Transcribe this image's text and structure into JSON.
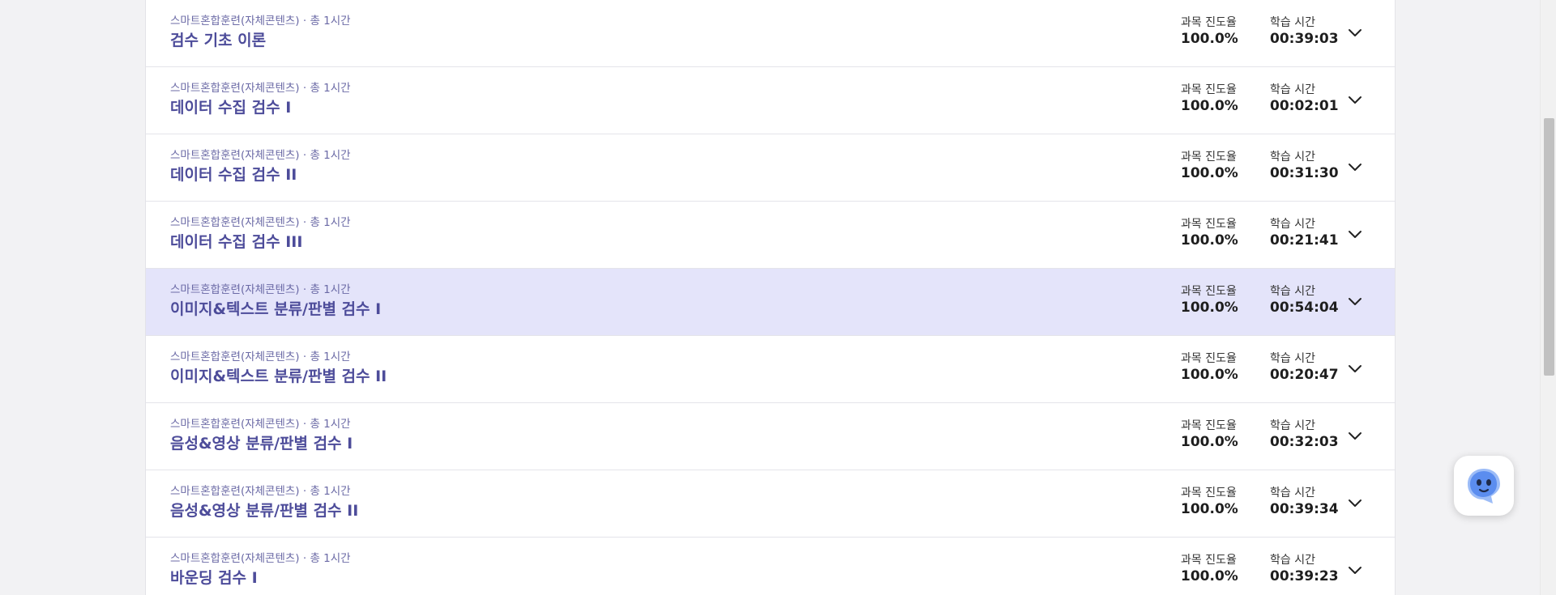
{
  "labels": {
    "progress": "과목 진도율",
    "time": "학습 시간"
  },
  "colors": {
    "title": "#4d4c9a",
    "meta": "#6b6aa6",
    "highlight_row": "#e4e4fa",
    "chatbot_accent": "#5b8def"
  },
  "icons": {
    "expand": "chevron-down-icon",
    "chatbot": "chatbot-icon"
  },
  "courses": [
    {
      "meta": "스마트혼합훈련(자체콘텐츠) · 총 1시간",
      "title": "검수 기초 이론",
      "progress": "100.0%",
      "time": "00:39:03",
      "highlighted": false
    },
    {
      "meta": "스마트혼합훈련(자체콘텐츠) · 총 1시간",
      "title": "데이터 수집 검수 I",
      "progress": "100.0%",
      "time": "00:02:01",
      "highlighted": false
    },
    {
      "meta": "스마트혼합훈련(자체콘텐츠) · 총 1시간",
      "title": "데이터 수집 검수 II",
      "progress": "100.0%",
      "time": "00:31:30",
      "highlighted": false
    },
    {
      "meta": "스마트혼합훈련(자체콘텐츠) · 총 1시간",
      "title": "데이터 수집 검수 III",
      "progress": "100.0%",
      "time": "00:21:41",
      "highlighted": false
    },
    {
      "meta": "스마트혼합훈련(자체콘텐츠) · 총 1시간",
      "title": "이미지&텍스트 분류/판별 검수 I",
      "progress": "100.0%",
      "time": "00:54:04",
      "highlighted": true
    },
    {
      "meta": "스마트혼합훈련(자체콘텐츠) · 총 1시간",
      "title": "이미지&텍스트 분류/판별 검수 II",
      "progress": "100.0%",
      "time": "00:20:47",
      "highlighted": false
    },
    {
      "meta": "스마트혼합훈련(자체콘텐츠) · 총 1시간",
      "title": "음성&영상 분류/판별 검수 I",
      "progress": "100.0%",
      "time": "00:32:03",
      "highlighted": false
    },
    {
      "meta": "스마트혼합훈련(자체콘텐츠) · 총 1시간",
      "title": "음성&영상 분류/판별 검수 II",
      "progress": "100.0%",
      "time": "00:39:34",
      "highlighted": false
    },
    {
      "meta": "스마트혼합훈련(자체콘텐츠) · 총 1시간",
      "title": "바운딩 검수 I",
      "progress": "100.0%",
      "time": "00:39:23",
      "highlighted": false
    }
  ]
}
